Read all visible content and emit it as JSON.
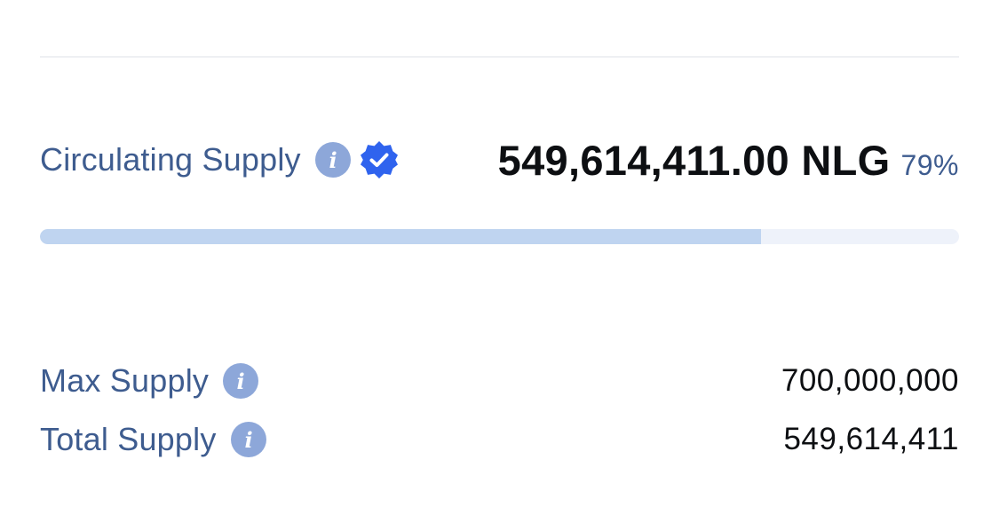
{
  "circulating_supply": {
    "label": "Circulating Supply",
    "info_icon": "info-icon",
    "verified_icon": "verified-badge-icon",
    "value": "549,614,411.00 NLG",
    "percent_label": "79%",
    "progress_fraction": 0.785
  },
  "max_supply": {
    "label": "Max Supply",
    "info_icon": "info-icon",
    "value": "700,000,000"
  },
  "total_supply": {
    "label": "Total Supply",
    "info_icon": "info-icon",
    "value": "549,614,411"
  },
  "colors": {
    "label": "#3e5c8f",
    "value": "#0d0f12",
    "info_icon_bg": "#8da7d9",
    "verified_badge": "#2f63ee",
    "progress_fill": "#bfd4f0",
    "progress_track": "#eef2fa",
    "divider": "#eef0f3"
  }
}
